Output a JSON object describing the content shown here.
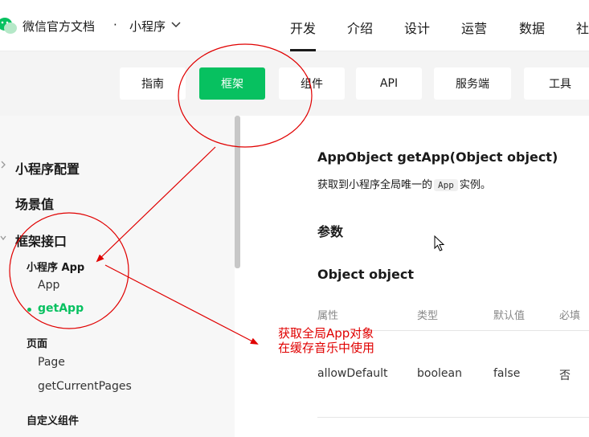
{
  "header": {
    "brand": "微信官方文档",
    "separator": "·",
    "product": "小程序",
    "nav": [
      "开发",
      "介绍",
      "设计",
      "运营",
      "数据",
      "社"
    ]
  },
  "subnav": {
    "tabs": [
      "指南",
      "框架",
      "组件",
      "API",
      "服务端",
      "工具"
    ],
    "active": "框架"
  },
  "sidebar": {
    "sections": [
      "小程序配置",
      "场景值",
      "框架接口"
    ],
    "groups": [
      "小程序 App",
      "页面",
      "自定义组件"
    ],
    "items": [
      "App",
      "getApp",
      "Page",
      "getCurrentPages"
    ],
    "active_item": "getApp"
  },
  "main": {
    "title": "AppObject getApp(Object object)",
    "desc_before": "获取到小程序全局唯一的",
    "desc_code": "App",
    "desc_after": "实例。",
    "params_title": "参数",
    "object_title": "Object object",
    "table": {
      "headers": [
        "属性",
        "类型",
        "默认值",
        "必填"
      ],
      "rows": [
        [
          "allowDefault",
          "boolean",
          "false",
          "否"
        ]
      ]
    }
  },
  "annotation": {
    "lines": [
      "获取全局App对象",
      "在缓存音乐中使用"
    ],
    "color": "#e00000"
  },
  "colors": {
    "accent": "#07c160",
    "annotation": "#e00000"
  }
}
